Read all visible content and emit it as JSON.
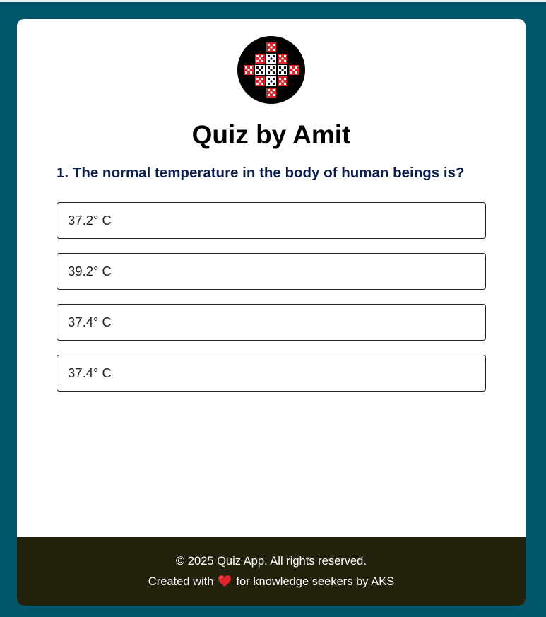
{
  "app": {
    "title": "Quiz by Amit"
  },
  "question": {
    "text": "1. The normal temperature in the body of human beings is?",
    "options": [
      {
        "label": "37.2° C"
      },
      {
        "label": "39.2° C"
      },
      {
        "label": "37.4° C"
      },
      {
        "label": "37.4° C"
      }
    ]
  },
  "footer": {
    "copyright": "© 2025 Quiz App. All rights reserved.",
    "created_prefix": "Created with",
    "created_suffix": "for knowledge seekers by AKS"
  },
  "icons": {
    "logo": "quiz-logo-icon",
    "heart": "heart-icon"
  },
  "colors": {
    "background": "#01566a",
    "card": "#ffffff",
    "footer": "#23230d",
    "question_text": "#0b1f4d",
    "heart": "#e0242c"
  }
}
